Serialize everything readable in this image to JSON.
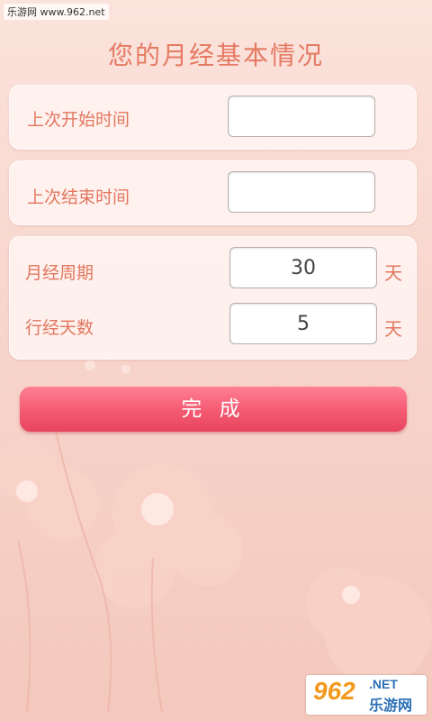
{
  "watermark": "乐游网 www.962.net",
  "title": "您的月经基本情况",
  "rows": [
    {
      "label": "上次开始时间",
      "value": ""
    },
    {
      "label": "上次结束时间",
      "value": ""
    },
    {
      "label": "月经周期",
      "value": "30",
      "unit": "天"
    },
    {
      "label": "行经天数",
      "value": "5",
      "unit": "天"
    }
  ],
  "done_button": "完 成",
  "logo": {
    "num": "962",
    "net": ".NET",
    "cn": "乐游网"
  },
  "colors": {
    "accent": "#e2775f",
    "button": "#f45a72",
    "background": "#f7d5cc"
  }
}
